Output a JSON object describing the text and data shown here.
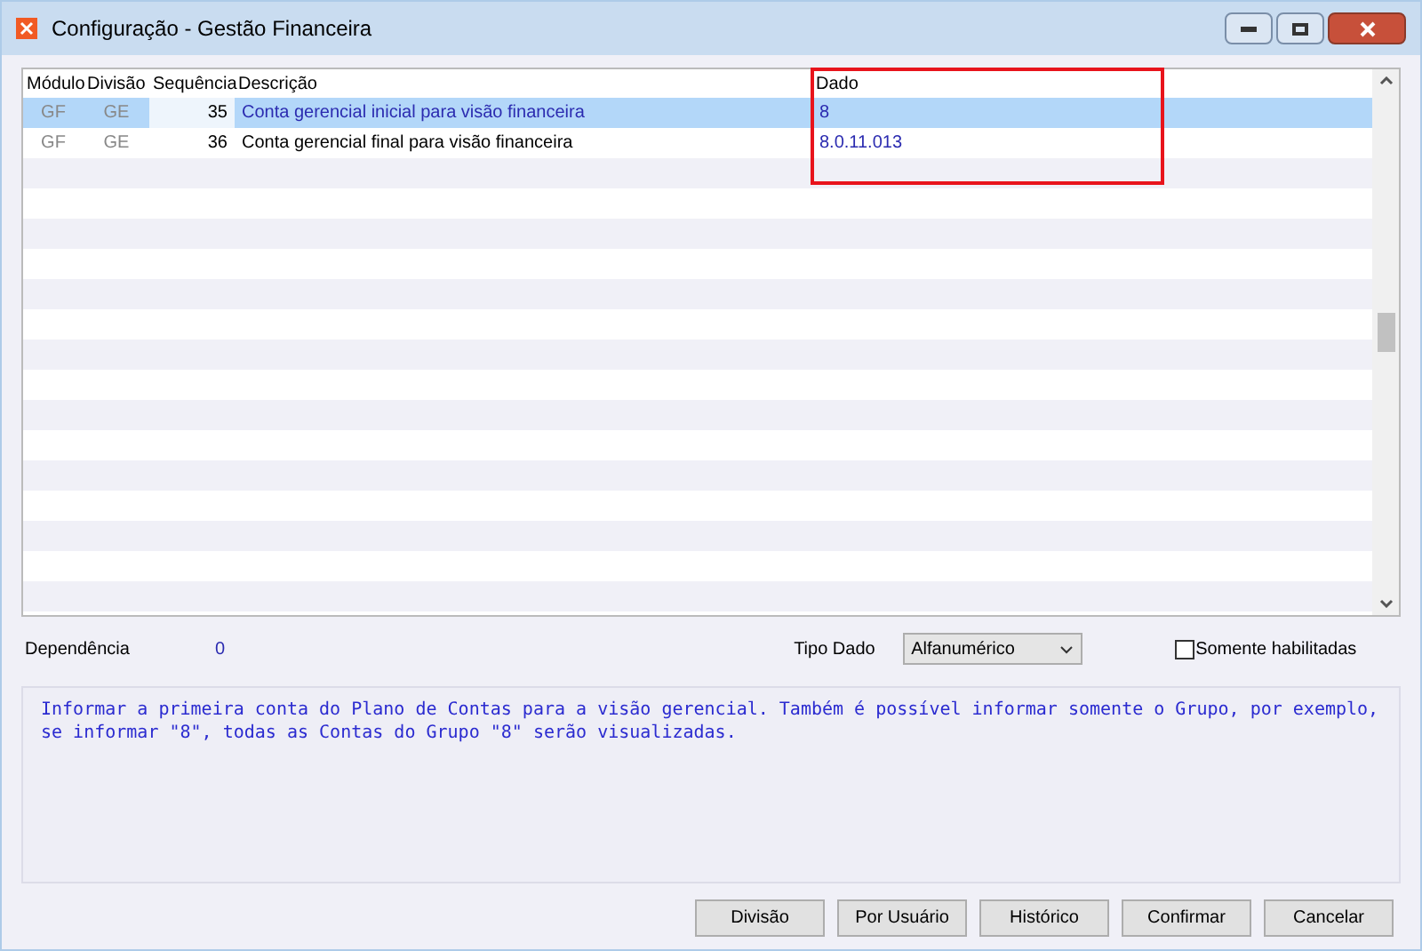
{
  "window": {
    "title": "Configuração - Gestão Financeira"
  },
  "table": {
    "columns": [
      "Módulo",
      "Divisão",
      "Sequência",
      "Descrição",
      "Dado"
    ],
    "rows": [
      {
        "cells": [
          "GF",
          "GE",
          "35",
          "Conta gerencial inicial para visão financeira",
          "8"
        ],
        "selected": true
      },
      {
        "cells": [
          "GF",
          "GE",
          "36",
          "Conta gerencial final para visão financeira",
          "8.0.11.013"
        ],
        "selected": false
      }
    ]
  },
  "dependency": {
    "label": "Dependência",
    "value": "0"
  },
  "data_type": {
    "label": "Tipo Dado",
    "value": "Alfanumérico"
  },
  "only_enabled": {
    "label": "Somente habilitadas",
    "checked": false
  },
  "help_text": "Informar a primeira conta do Plano de Contas para a visão gerencial. Também é possível informar somente o Grupo, por exemplo, se informar \"8\", todas as Contas do Grupo \"8\" serão visualizadas.",
  "buttons": [
    "Divisão",
    "Por Usuário",
    "Histórico",
    "Confirmar",
    "Cancelar"
  ]
}
